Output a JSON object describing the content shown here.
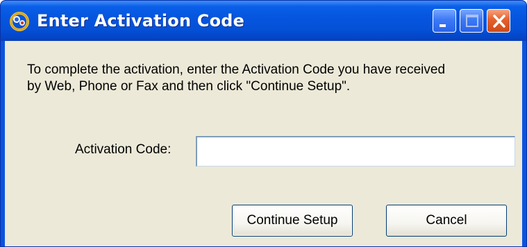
{
  "window": {
    "title": "Enter Activation Code",
    "icon": "activation-app-icon",
    "controls": [
      "minimize-icon",
      "maximize-icon",
      "close-icon"
    ]
  },
  "dialog": {
    "message": "To complete the activation, enter the Activation Code you have received\nby Web, Phone or Fax and then click \"Continue Setup\".",
    "field_label": "Activation Code:",
    "field_value": "",
    "continue_label": "Continue Setup",
    "cancel_label": "Cancel"
  },
  "colors": {
    "titlebar": "#0656df",
    "client_background": "#ece9d8",
    "close_button": "#e5602c"
  }
}
